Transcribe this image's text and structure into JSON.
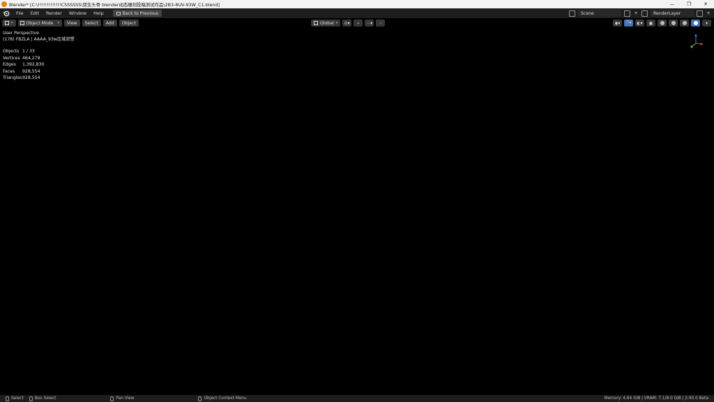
{
  "window": {
    "title": "Blender* [C:\\!!!!!!!!!!!!!CSSSSSS\\双生头骨  blender动态雕刻投稿测试作品\\2B3-8UV-93W_C1.blend]",
    "minimize": "—",
    "maximize": "❐",
    "close": "✕"
  },
  "topbar": {
    "menus": [
      "File",
      "Edit",
      "Render",
      "Window",
      "Help"
    ],
    "back_button": "Back to Previous",
    "scene_value": "Scene",
    "layer_value": "RenderLayer"
  },
  "viewport_header": {
    "mode": "Object Mode",
    "menus": [
      "View",
      "Select",
      "Add",
      "Object"
    ],
    "transform_orientation": "Global"
  },
  "overlay": {
    "view_name": "User Perspective",
    "object_info": "(178) FBZLA | AAAA_93w区域泥塑"
  },
  "stats": [
    {
      "label": "Objects",
      "value": "1 / 33"
    },
    {
      "label": "Vertices",
      "value": "464,279"
    },
    {
      "label": "Edges",
      "value": "1,392,830"
    },
    {
      "label": "Faces",
      "value": "928,554"
    },
    {
      "label": "Triangles",
      "value": "928,554"
    }
  ],
  "statusbar": {
    "select": "Select",
    "box_select": "Box Select",
    "pan_view": "Pan View",
    "context_menu": "Object Context Menu",
    "info": "Memory: 4.84 GiB | VRAM: 7.1/8.0 GiB | 2.90.0 Beta"
  },
  "colors": {
    "accent": "#4772b3",
    "gold": "#d9a23a",
    "teal": "#1fd27a"
  }
}
